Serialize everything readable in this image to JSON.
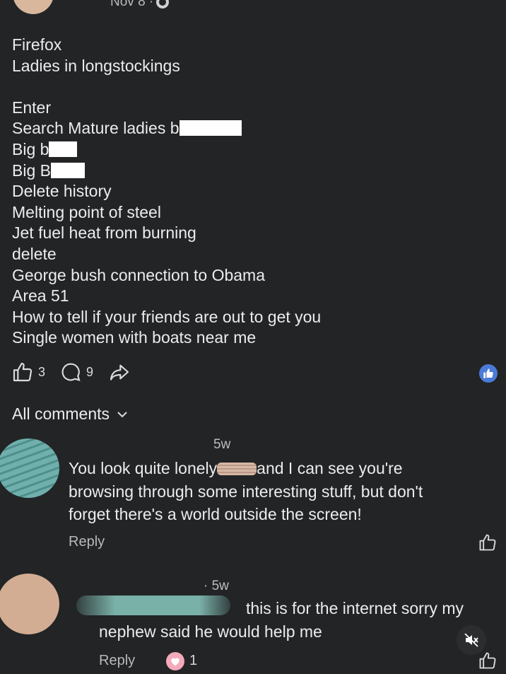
{
  "post": {
    "date": "Nov 8 ·",
    "lines": [
      "Firefox",
      "Ladies in longstockings",
      "",
      "Enter",
      "Search Mature ladies b",
      "Big b",
      "Big B",
      "Delete history",
      "Melting point of steel",
      "Jet fuel heat from burning",
      "delete",
      "George bush connection to Obama",
      "Area 51",
      "How to tell if your friends are out to get you",
      "Single women with boats near me"
    ]
  },
  "actions": {
    "like_count": "3",
    "comment_count": "9",
    "icons": [
      "thumbs-up-icon",
      "comment-icon",
      "share-icon",
      "like-badge-icon"
    ]
  },
  "comments_header": {
    "label": "All comments"
  },
  "comments": [
    {
      "time": "5w",
      "text_a": "You look quite lonely",
      "text_b": "and I can see you're",
      "text_c": "browsing through some interesting stuff, but don't",
      "text_d": "forget there's a world outside the screen!",
      "reply_label": "Reply"
    },
    {
      "time": "· 5w",
      "line1": "this is for the internet sorry my",
      "line2": "nephew said he would help me",
      "reply_label": "Reply",
      "reaction_count": "1"
    }
  ],
  "colors": {
    "background": "#232426",
    "text": "#ececed",
    "like_badge": "#4a7bd8",
    "heart_badge": "#f3aabb"
  }
}
